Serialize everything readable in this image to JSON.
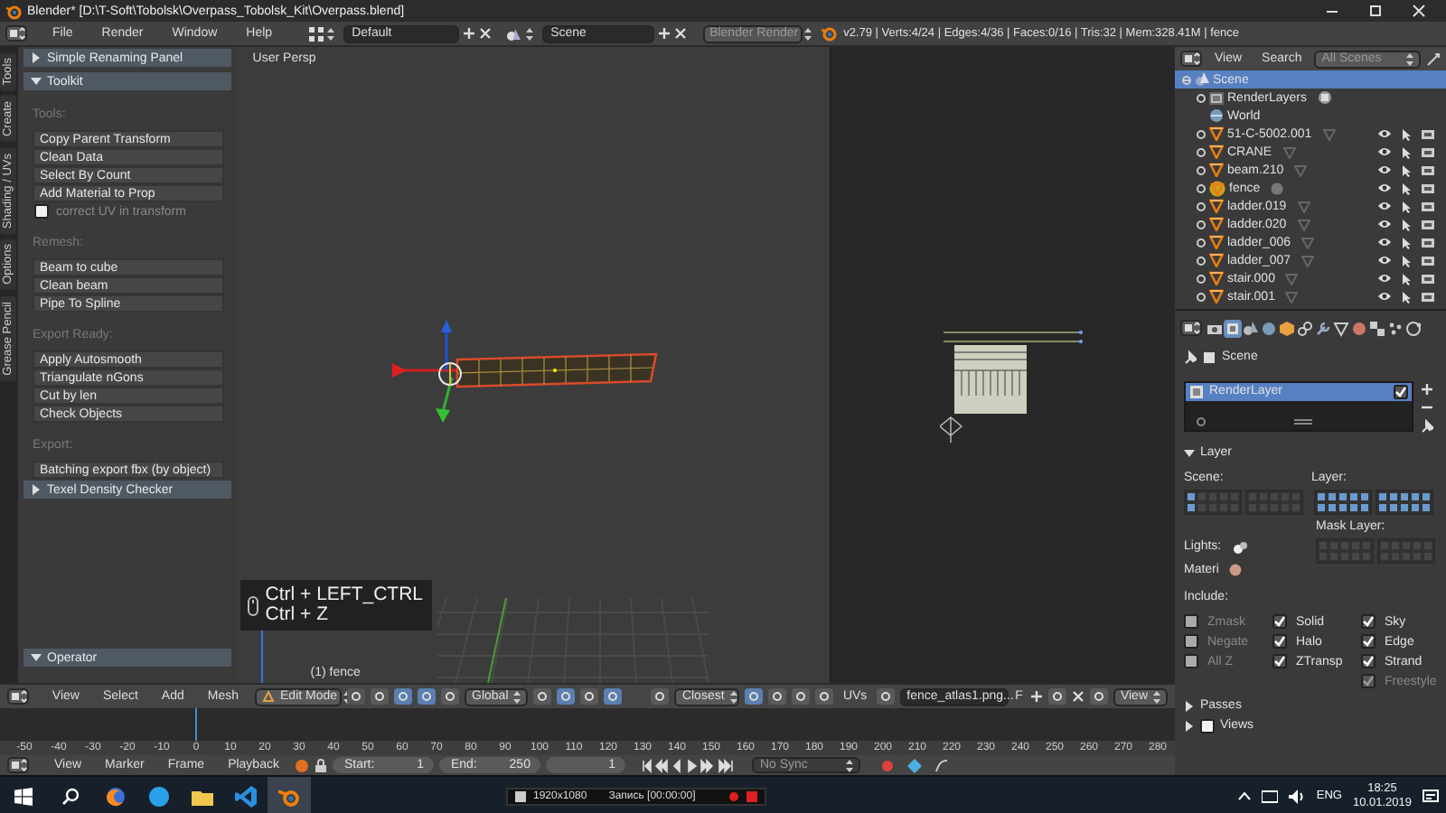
{
  "title_bar": {
    "title": "Blender* [D:\\T-Soft\\Tobolsk\\Overpass_Tobolsk_Kit\\Overpass.blend]"
  },
  "menu_bar": {
    "menus": [
      "File",
      "Render",
      "Window",
      "Help"
    ],
    "layout": "Default",
    "scene": "Scene",
    "engine": "Blender Render",
    "stats": "v2.79 | Verts:4/24 | Edges:4/36 | Faces:0/16 | Tris:32 | Mem:328.41M | fence"
  },
  "tool_shelf": {
    "tabs": [
      {
        "label": "Tools",
        "selected": false
      },
      {
        "label": "Create",
        "selected": false
      },
      {
        "label": "Shading / UVs",
        "selected": false
      },
      {
        "label": "Options",
        "selected": false
      },
      {
        "label": "Grease Pencil",
        "selected": false
      }
    ],
    "panels": [
      {
        "title": "Simple Renaming Panel",
        "expanded": false
      },
      {
        "title": "Toolkit",
        "expanded": true,
        "sections": [
          {
            "heading": "Tools:",
            "items": [
              {
                "kind": "button",
                "label": "Copy Parent Transform"
              },
              {
                "kind": "button",
                "label": "Clean Data"
              },
              {
                "kind": "button",
                "label": "Select By Count"
              },
              {
                "kind": "button",
                "label": "Add Material to Prop"
              },
              {
                "kind": "checkbox",
                "label": "correct UV in transform",
                "checked": false
              }
            ]
          },
          {
            "heading": "Remesh:",
            "items": [
              {
                "kind": "button",
                "label": "Beam to cube"
              },
              {
                "kind": "button",
                "label": "Clean beam"
              },
              {
                "kind": "button",
                "label": "Pipe To Spline"
              }
            ]
          },
          {
            "heading": "Export Ready:",
            "items": [
              {
                "kind": "button",
                "label": "Apply Autosmooth"
              },
              {
                "kind": "button",
                "label": "Triangulate nGons"
              },
              {
                "kind": "button",
                "label": "Cut by len"
              },
              {
                "kind": "button",
                "label": "Check Objects"
              }
            ]
          },
          {
            "heading": "Export:",
            "items": [
              {
                "kind": "button",
                "label": "Batching export fbx (by object)"
              }
            ]
          }
        ]
      },
      {
        "title": "Texel Density Checker",
        "expanded": false
      }
    ],
    "operator_panel": {
      "title": "Operator",
      "expanded": true
    }
  },
  "viewport": {
    "view_label": "User Persp",
    "object_label": "(1) fence",
    "key_overlay": [
      "Ctrl + LEFT_CTRL",
      "Ctrl + Z"
    ]
  },
  "viewport_header": {
    "menus": [
      "View",
      "Select",
      "Add",
      "Mesh"
    ],
    "mode": "Edit Mode",
    "orientation": "Global",
    "snap_target": "Closest",
    "uv_label": "UVs",
    "image": "fence_atlas1.png...",
    "fake_user": "F",
    "image_menu": "View"
  },
  "timeline": {
    "ruler": [
      "-50",
      "-40",
      "-30",
      "-20",
      "-10",
      "0",
      "10",
      "20",
      "30",
      "40",
      "50",
      "60",
      "70",
      "80",
      "90",
      "100",
      "110",
      "120",
      "130",
      "140",
      "150",
      "160",
      "170",
      "180",
      "190",
      "200",
      "210",
      "220",
      "230",
      "240",
      "250",
      "260",
      "270",
      "280"
    ],
    "menus": [
      "View",
      "Marker",
      "Frame",
      "Playback"
    ],
    "start_label": "Start:",
    "start": "1",
    "end_label": "End:",
    "end": "250",
    "current_frame": "1",
    "sync": "No Sync"
  },
  "outliner": {
    "menus": [
      "View",
      "Search"
    ],
    "filter": "All Scenes",
    "tree": [
      {
        "label": "Scene",
        "kind": "scene",
        "selected": true,
        "expanded": true,
        "children": [
          {
            "label": "RenderLayers",
            "kind": "renderlayers",
            "selected": false,
            "expanded": false
          },
          {
            "label": "World",
            "kind": "world",
            "selected": false
          },
          {
            "label": "51-C-5002.001",
            "kind": "mesh",
            "selected": false,
            "expanded": false,
            "active": false
          },
          {
            "label": "CRANE",
            "kind": "mesh",
            "selected": false,
            "expanded": false,
            "active": false
          },
          {
            "label": "beam.210",
            "kind": "mesh",
            "selected": false,
            "expanded": false,
            "active": false
          },
          {
            "label": "fence",
            "kind": "mesh",
            "selected": false,
            "expanded": false,
            "active": true
          },
          {
            "label": "ladder.019",
            "kind": "mesh",
            "selected": false,
            "expanded": false,
            "active": false
          },
          {
            "label": "ladder.020",
            "kind": "mesh",
            "selected": false,
            "expanded": false,
            "active": false
          },
          {
            "label": "ladder_006",
            "kind": "mesh",
            "selected": false,
            "expanded": false,
            "active": false
          },
          {
            "label": "ladder_007",
            "kind": "mesh",
            "selected": false,
            "expanded": false,
            "active": false
          },
          {
            "label": "stair.000",
            "kind": "mesh",
            "selected": false,
            "expanded": false,
            "active": false
          },
          {
            "label": "stair.001",
            "kind": "mesh",
            "selected": false,
            "expanded": false,
            "active": false
          }
        ]
      }
    ]
  },
  "properties": {
    "tabs": [
      {
        "kind": "render",
        "selected": false
      },
      {
        "kind": "render_layers",
        "selected": true
      },
      {
        "kind": "scene",
        "selected": false
      },
      {
        "kind": "world",
        "selected": false
      },
      {
        "kind": "object",
        "selected": false
      },
      {
        "kind": "constraints",
        "selected": false
      },
      {
        "kind": "modifiers",
        "selected": false
      },
      {
        "kind": "data",
        "selected": false
      },
      {
        "kind": "material",
        "selected": false
      },
      {
        "kind": "texture",
        "selected": false
      },
      {
        "kind": "particles",
        "selected": false
      },
      {
        "kind": "physics",
        "selected": false
      }
    ],
    "context": "Scene",
    "render_layers": [
      {
        "label": "RenderLayer",
        "checked": true,
        "selected": true
      }
    ],
    "layer_panel": {
      "title": "Layer",
      "expanded": true,
      "scene_label": "Scene:",
      "layer_label": "Layer:",
      "mask_label": "Mask Layer:",
      "lights_label": "Lights:",
      "material_label": "Materi",
      "include_label": "Include:",
      "scene_layers": [
        true,
        false,
        false,
        false,
        false,
        true,
        false,
        false,
        false,
        false,
        false,
        false,
        false,
        false,
        false,
        false,
        false,
        false,
        false,
        false
      ],
      "layers": [
        true,
        true,
        true,
        true,
        true,
        true,
        true,
        true,
        true,
        true,
        true,
        true,
        true,
        true,
        true,
        true,
        true,
        true,
        true,
        true
      ],
      "mask_layers": [
        false,
        false,
        false,
        false,
        false,
        false,
        false,
        false,
        false,
        false,
        false,
        false,
        false,
        false,
        false,
        false,
        false,
        false,
        false,
        false
      ],
      "include": [
        [
          {
            "label": "Zmask",
            "checked": false,
            "disabled": true
          },
          {
            "label": "Negate",
            "checked": false,
            "disabled": true
          },
          {
            "label": "All Z",
            "checked": false,
            "disabled": true
          }
        ],
        [
          {
            "label": "Solid",
            "checked": true,
            "disabled": false
          },
          {
            "label": "Halo",
            "checked": true,
            "disabled": false
          },
          {
            "label": "ZTransp",
            "checked": true,
            "disabled": false
          }
        ],
        [
          {
            "label": "Sky",
            "checked": true,
            "disabled": false
          },
          {
            "label": "Edge",
            "checked": true,
            "disabled": false
          },
          {
            "label": "Strand",
            "checked": true,
            "disabled": false
          },
          {
            "label": "Freestyle",
            "checked": true,
            "disabled": true
          }
        ]
      ]
    },
    "passes": {
      "title": "Passes",
      "expanded": false
    },
    "views": {
      "title": "Views",
      "expanded": false,
      "checked": false
    }
  },
  "taskbar": {
    "apps": [
      {
        "kind": "browser",
        "selected": false
      },
      {
        "kind": "chat",
        "selected": false
      },
      {
        "kind": "folder",
        "selected": false
      },
      {
        "kind": "code",
        "selected": false
      },
      {
        "kind": "blender",
        "selected": true
      }
    ],
    "recorder": {
      "resolution": "1920x1080",
      "status": "Запись [00:00:00]"
    },
    "tray": {
      "language": "ENG",
      "time": "18:25",
      "date": "10.01.2019"
    }
  }
}
